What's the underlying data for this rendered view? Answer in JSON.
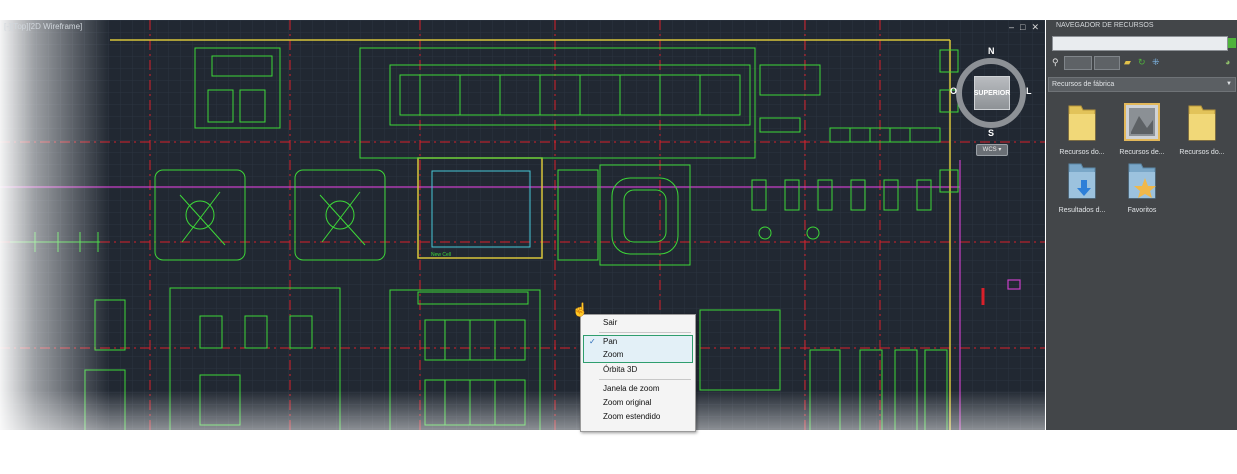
{
  "viewport": {
    "title": "[-][Top][2D Wireframe]",
    "controls": [
      "–",
      "□",
      "✕"
    ],
    "drawing_label": "New Cell"
  },
  "viewcube": {
    "face": "SUPERIOR",
    "north": "N",
    "south": "S",
    "east": "L",
    "west": "O",
    "wcs": "WCS ▾"
  },
  "context_menu": {
    "items": [
      "Sair",
      "Pan",
      "Zoom",
      "Órbita 3D",
      "Janela de zoom",
      "Zoom original",
      "Zoom estendido"
    ],
    "checked": "Pan"
  },
  "panel": {
    "title": "NAVEGADOR DE RECURSOS",
    "dropdown": "Recursos de fábrica",
    "icons": [
      {
        "label": "Recursos do...",
        "icon": "folder-icon"
      },
      {
        "label": "Recursos de...",
        "icon": "image-folder-icon"
      },
      {
        "label": "Recursos do...",
        "icon": "folder-icon"
      },
      {
        "label": "Resultados d...",
        "icon": "search-results-folder-icon"
      },
      {
        "label": "Favoritos",
        "icon": "favorites-folder-icon"
      }
    ]
  },
  "colors": {
    "background": "#212832",
    "cad_green": "#3dd838",
    "grid_red": "#d9202a",
    "magenta": "#c83fc8",
    "yellow": "#d8c63a",
    "cyan": "#48c8d8"
  }
}
